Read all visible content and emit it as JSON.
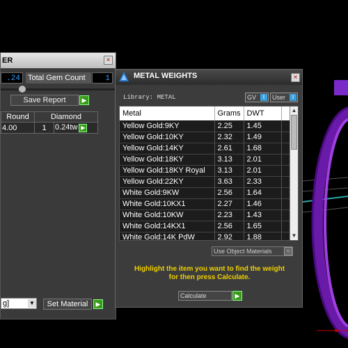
{
  "left_panel": {
    "title_fragment": "ER",
    "close_glyph": "×",
    "small_value": ".24",
    "total_gem_count_label": "Total Gem Count",
    "total_gem_count_value": "1",
    "save_report_label": "Save Report",
    "table_headers": [
      "Round",
      "Diamond"
    ],
    "table_row": [
      "4.00",
      "1",
      "0.24tw"
    ],
    "dropdown_value": "g]",
    "set_material_label": "Set Material"
  },
  "metal_dialog": {
    "title": "METAL WEIGHTS",
    "close_glyph": "×",
    "library_label": "Library: METAL",
    "gv_label": "GV",
    "user_label": "User",
    "toggle_marker": "I",
    "columns": [
      "Metal",
      "Grams",
      "DWT"
    ],
    "rows": [
      [
        "Yellow Gold:9KY",
        "2.25",
        "1.45"
      ],
      [
        "Yellow Gold:10KY",
        "2.32",
        "1.49"
      ],
      [
        "Yellow Gold:14KY",
        "2.61",
        "1.68"
      ],
      [
        "Yellow Gold:18KY",
        "3.13",
        "2.01"
      ],
      [
        "Yellow Gold:18KY Royal",
        "3.13",
        "2.01"
      ],
      [
        "Yellow Gold:22KY",
        "3.63",
        "2.33"
      ],
      [
        "White Gold:9KW",
        "2.56",
        "1.64"
      ],
      [
        "White Gold:10KX1",
        "2.27",
        "1.46"
      ],
      [
        "White Gold:10KW",
        "2.23",
        "1.43"
      ],
      [
        "White Gold:14KX1",
        "2.56",
        "1.65"
      ],
      [
        "White Gold:14K PdW",
        "2.92",
        "1.88"
      ]
    ],
    "use_object_materials_label": "Use Object Materials",
    "hint_line1": "Highlight the item you want to find the weight",
    "hint_line2": "for then press Calculate.",
    "calculate_label": "Calculate"
  },
  "colors": {
    "accent_yellow": "#f0d000",
    "accent_green": "#3a9a1a",
    "ring_purple": "#8a2bd0"
  }
}
